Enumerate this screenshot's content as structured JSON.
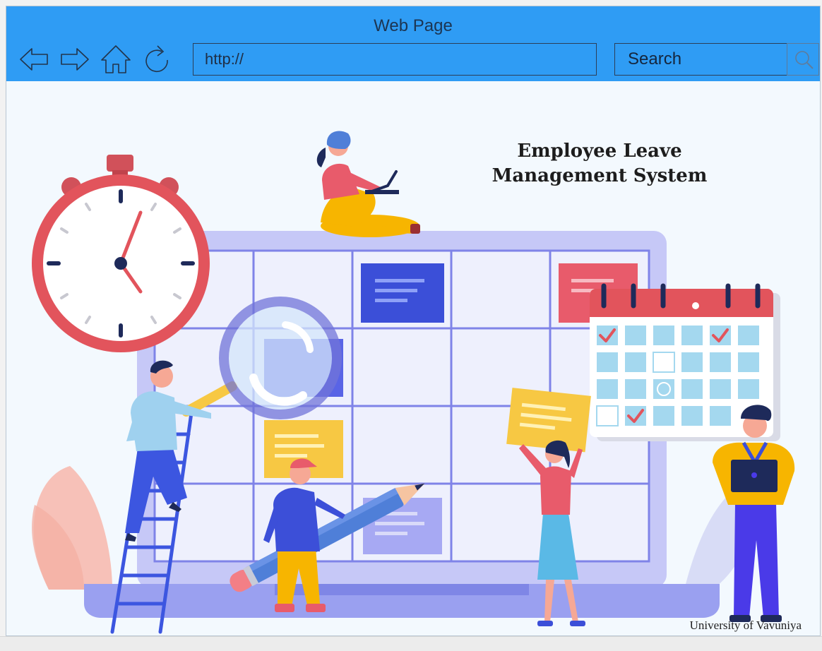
{
  "window": {
    "title": "Web Page"
  },
  "toolbar": {
    "back_icon": "back-arrow-icon",
    "forward_icon": "forward-arrow-icon",
    "home_icon": "home-icon",
    "refresh_icon": "refresh-icon",
    "url_value": "http://",
    "search_label": "Search",
    "search_icon": "magnifier-icon"
  },
  "page": {
    "heading_line1": "Employee Leave",
    "heading_line2": "Management System",
    "footer": "University of Vavuniya"
  },
  "colors": {
    "titlebar": "#2f9cf4",
    "board": "#c9cbf6",
    "clock_red": "#e2545c",
    "accent_blue": "#3b4fd8",
    "note_yellow": "#f7c843"
  }
}
